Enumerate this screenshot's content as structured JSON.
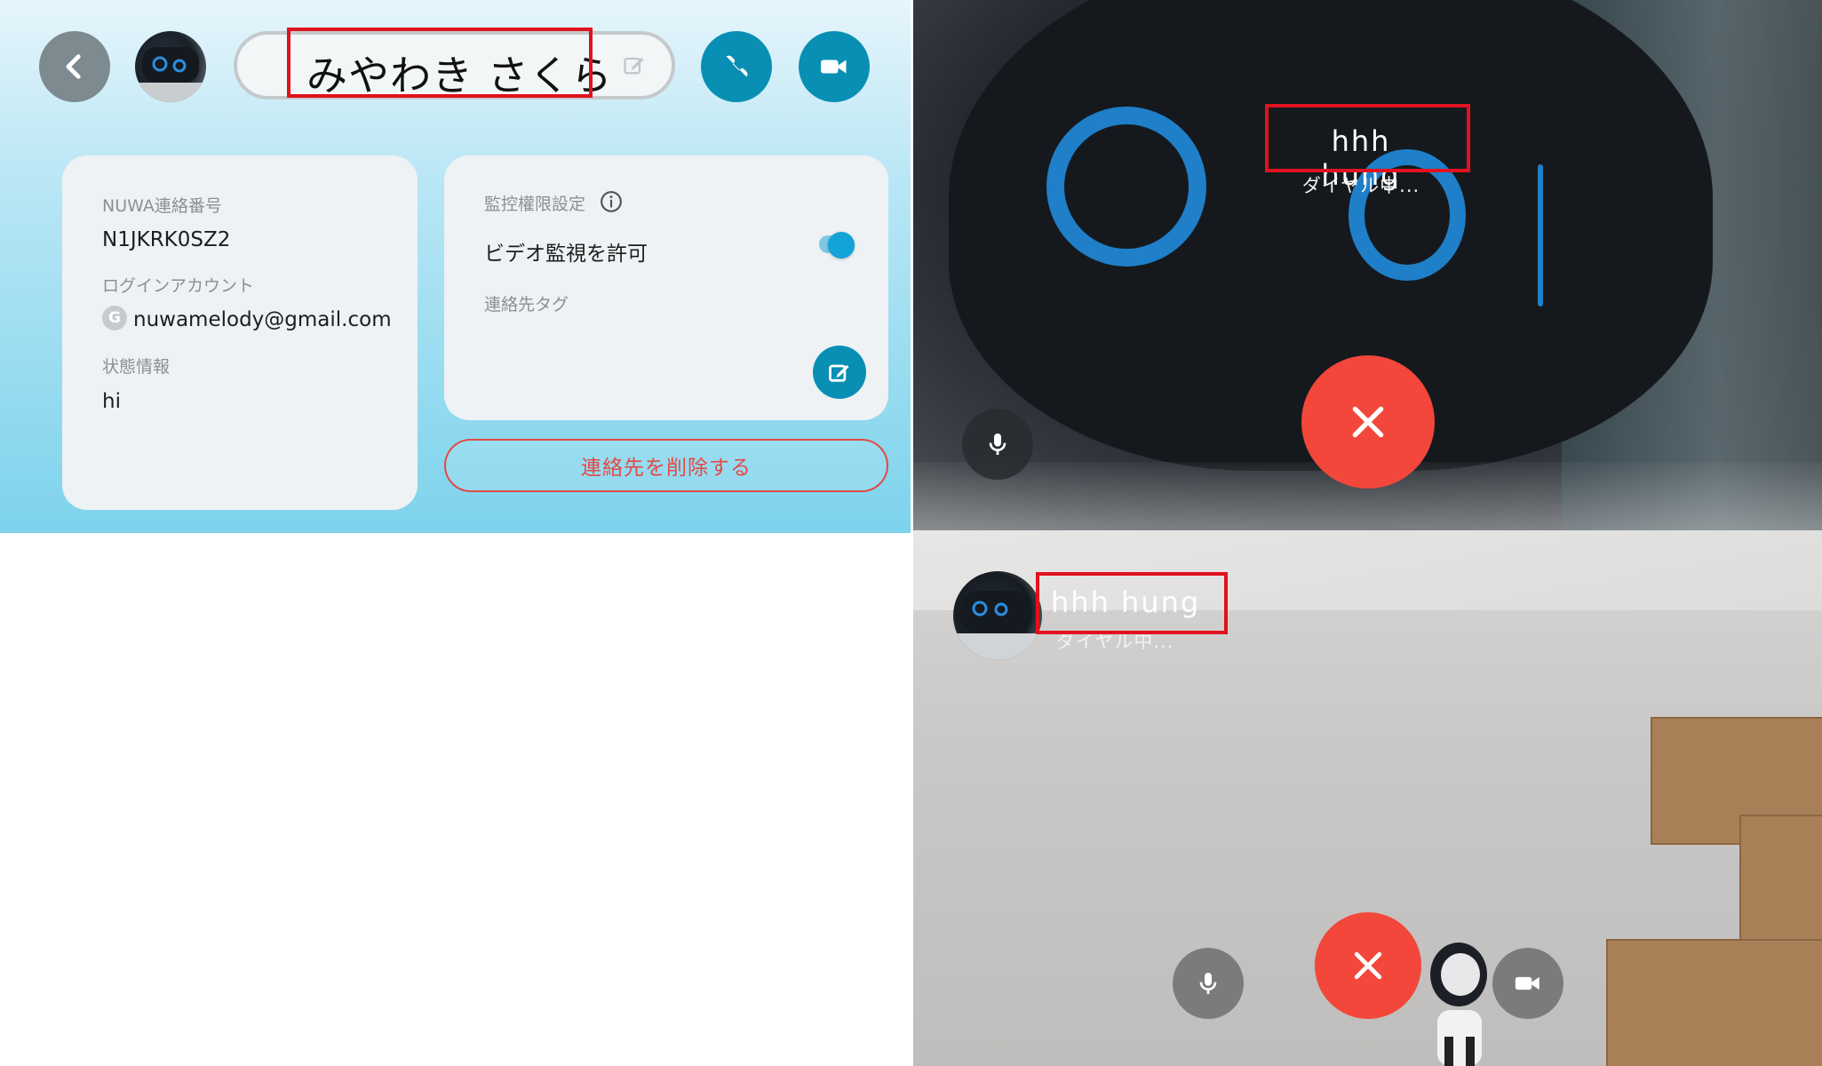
{
  "contact": {
    "name": "みやわき さくら",
    "nuwa_id_label": "NUWA連絡番号",
    "nuwa_id_value": "N1JKRK0SZ2",
    "login_account_label": "ログインアカウント",
    "login_account_badge": "G",
    "login_account_value": "nuwamelody@gmail.com",
    "status_label": "状態情報",
    "status_value": "hi"
  },
  "permissions": {
    "section_title": "監控權限設定",
    "video_monitor_label": "ビデオ監視を許可",
    "video_monitor_enabled": true,
    "contact_tag_label": "連絡先タグ"
  },
  "actions": {
    "delete_contact": "連絡先を削除する"
  },
  "call_top": {
    "caller_name": "hhh hung",
    "status": "ダイヤル中..."
  },
  "call_bottom": {
    "caller_name": "hhh hung",
    "status": "ダイヤル中..."
  },
  "colors": {
    "accent": "#0a8fb4",
    "hangup": "#f2473a",
    "delete_text": "#e34a43",
    "highlight_box": "#e0121e"
  },
  "icons": [
    "chevron-left-icon",
    "edit-icon",
    "phone-icon",
    "video-camera-icon",
    "info-icon",
    "microphone-icon",
    "close-icon"
  ]
}
